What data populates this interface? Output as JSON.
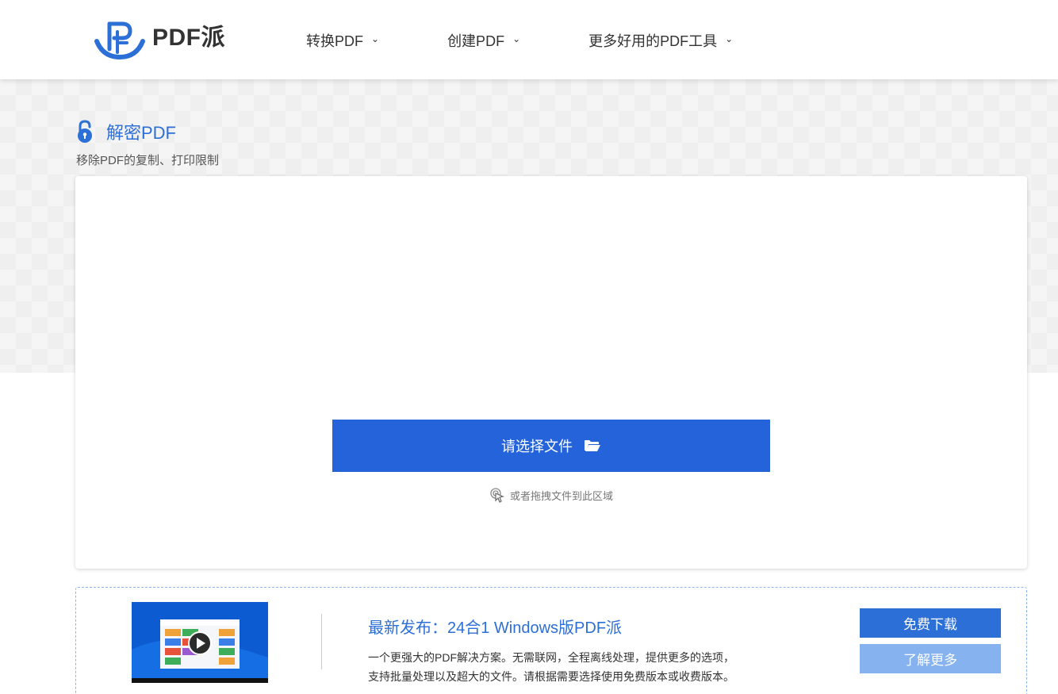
{
  "header": {
    "logo_text": "PDF派",
    "nav": [
      {
        "label": "转换PDF"
      },
      {
        "label": "创建PDF"
      },
      {
        "label": "更多好用的PDF工具"
      }
    ]
  },
  "tool": {
    "title": "解密PDF",
    "subtitle": "移除PDF的复制、打印限制"
  },
  "upload": {
    "select_label": "请选择文件",
    "drag_hint": "或者拖拽文件到此区域"
  },
  "promo": {
    "title": "最新发布：24合1 Windows版PDF派",
    "desc_line1": "一个更强大的PDF解决方案。无需联网，全程离线处理，提供更多的选项，",
    "desc_line2": "支持批量处理以及超大的文件。请根据需要选择使用免费版本或收费版本。",
    "download_label": "免费下载",
    "more_label": "了解更多"
  },
  "colors": {
    "primary": "#2563da",
    "title_blue": "#2c6fd6",
    "light_button": "#86b2ef"
  },
  "icons": [
    "logo-mark-icon",
    "chevron-down-icon",
    "unlock-icon",
    "folder-open-icon",
    "pointer-icon",
    "play-icon"
  ]
}
